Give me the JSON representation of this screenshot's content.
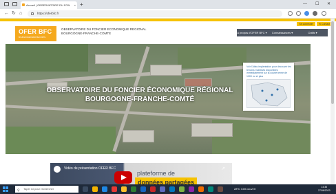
{
  "browser": {
    "tab_title": "Accueil | OBSERVATOIRE DU FON",
    "tab_close": "×",
    "new_tab": "+",
    "url": "https://oferbfc.fr",
    "win_min": "—",
    "win_max": "☐",
    "win_close": "✕",
    "nav": {
      "back": "←",
      "refresh": "↻",
      "home": "⌂"
    }
  },
  "site": {
    "util_links": [
      "Se connecter",
      "✉ Contact"
    ],
    "logo_title": "OFER BFC",
    "logo_subtitle": "BOURGOGNE FRANCHE-COMTE",
    "header_title_line1": "OBSERVATOIRE DU FONCIER ECONOMIQUE REGIONAL",
    "header_title_line2": "BOURGOGNE-FRANCHE-COMTE",
    "menu": [
      "A propos d'OFER BFC ▾",
      "Connaissances ▾",
      "Outils ▾"
    ],
    "hero_title_line1": "OBSERVATOIRE DU FONCIER ÉCONOMIQUE RÉGIONAL",
    "hero_title_line2": "BOURGOGNE-FRANCHE-COMTÉ",
    "hero_card_text": "Voir l'Atlas implantation pour découvrir les terrains mobilisés disponibles immédiatement sur la courte terme de 1000 m² et plus",
    "video": {
      "channel_label": "OFER",
      "title": "Vidéo de présentation OFER BFC",
      "share_icon": "↗",
      "line1": "plateforme de",
      "line2": "données partagées"
    }
  },
  "taskbar": {
    "search_placeholder": "Taper ici pour rechercher",
    "search_icon": "⚲",
    "weather": "28°C  Ciel couvert",
    "time": "14:35",
    "date": "27/06/2023"
  },
  "colors": {
    "accent": "#f6c200",
    "logo": "#f5a91e",
    "menu": "#4d5562",
    "taskbar": "#1f2a3a"
  }
}
